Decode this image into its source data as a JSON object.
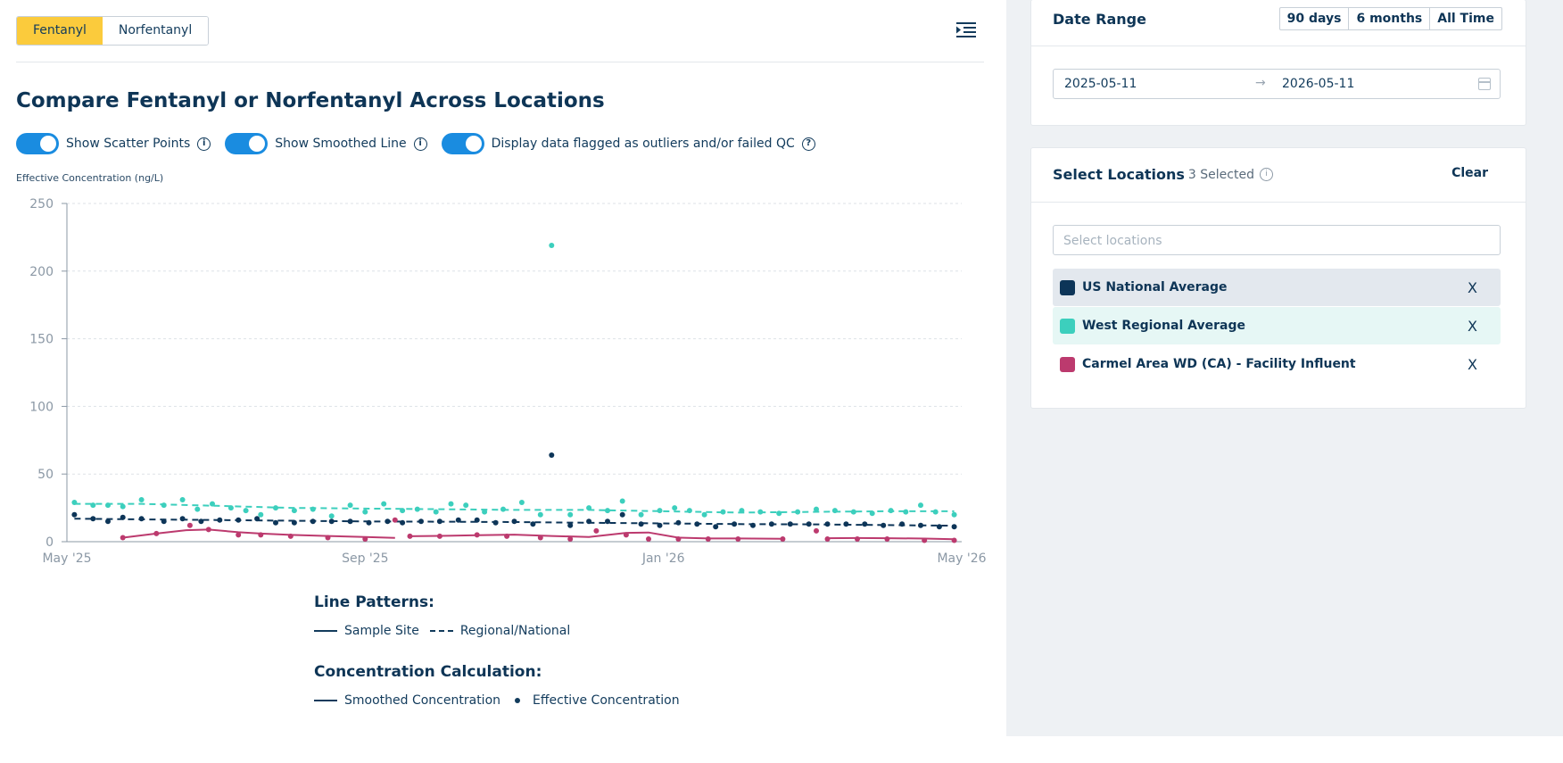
{
  "tabs": [
    {
      "label": "Fentanyl",
      "active": true
    },
    {
      "label": "Norfentanyl",
      "active": false
    }
  ],
  "page_title": "Compare Fentanyl or Norfentanyl Across Locations",
  "toggles": [
    {
      "label": "Show Scatter Points",
      "on": true,
      "icon": "info-icon"
    },
    {
      "label": "Show Smoothed Line",
      "on": true,
      "icon": "info-icon"
    },
    {
      "label": "Display data flagged as outliers and/or failed QC",
      "on": true,
      "icon": "help-icon"
    }
  ],
  "legend": {
    "patterns_title": "Line Patterns:",
    "sample_site": "Sample Site",
    "regional_national": "Regional/National",
    "calc_title": "Concentration Calculation:",
    "smoothed": "Smoothed Concentration",
    "effective": "Effective Concentration"
  },
  "date_range": {
    "title": "Date Range",
    "buttons": [
      "90 days",
      "6 months",
      "All Time"
    ],
    "start": "2025-05-11",
    "arrow": "→",
    "end": "2026-05-11"
  },
  "locations": {
    "title": "Select Locations",
    "count": "3 Selected",
    "clear": "Clear",
    "placeholder": "Select locations",
    "items": [
      {
        "name": "US National Average",
        "color": "#0d3558",
        "bg": "#e3e8ee"
      },
      {
        "name": "West Regional Average",
        "color": "#3ccfbd",
        "bg": "#e6f7f5"
      },
      {
        "name": "Carmel Area WD (CA) - Facility Influent",
        "color": "#bc3a6e",
        "bg": "#ffffff"
      }
    ],
    "remove": "X"
  },
  "colors": {
    "accent": "#fbcb3c",
    "toggle": "#1a8ce0",
    "navy": "#0d3558",
    "teal": "#3ccfbd",
    "magenta": "#bc3a6e"
  },
  "chart_data": {
    "type": "line",
    "ylabel": "Effective Concentration (ng/L)",
    "ylim": [
      0,
      250
    ],
    "yticks": [
      0,
      50,
      100,
      150,
      200,
      250
    ],
    "xticks": [
      {
        "label": "May '25",
        "t": 0
      },
      {
        "label": "Sep '25",
        "t": 4
      },
      {
        "label": "Jan '26",
        "t": 8
      },
      {
        "label": "May '26",
        "t": 12
      }
    ],
    "xlim": [
      0,
      12
    ],
    "grid": true,
    "series": [
      {
        "name": "US National Average",
        "color": "#0d3558",
        "dashed": true,
        "smoothed": [
          [
            0.1,
            17
          ],
          [
            1,
            16.5
          ],
          [
            2,
            16
          ],
          [
            3,
            15.5
          ],
          [
            4,
            15
          ],
          [
            5,
            14.8
          ],
          [
            6,
            14.5
          ],
          [
            7,
            14
          ],
          [
            8,
            13.5
          ],
          [
            9,
            13
          ],
          [
            10,
            12.8
          ],
          [
            11,
            12.3
          ],
          [
            11.9,
            11.8
          ]
        ],
        "points": [
          [
            0.1,
            20
          ],
          [
            0.35,
            17
          ],
          [
            0.55,
            15
          ],
          [
            0.75,
            18
          ],
          [
            1,
            17
          ],
          [
            1.3,
            15
          ],
          [
            1.55,
            17
          ],
          [
            1.8,
            15
          ],
          [
            2.05,
            16
          ],
          [
            2.3,
            16
          ],
          [
            2.55,
            17
          ],
          [
            2.8,
            14
          ],
          [
            3.05,
            14
          ],
          [
            3.3,
            15
          ],
          [
            3.55,
            15
          ],
          [
            3.8,
            15
          ],
          [
            4.05,
            14
          ],
          [
            4.3,
            15
          ],
          [
            4.5,
            14
          ],
          [
            4.75,
            15
          ],
          [
            5,
            15
          ],
          [
            5.25,
            16
          ],
          [
            5.5,
            16
          ],
          [
            5.75,
            14
          ],
          [
            6,
            15
          ],
          [
            6.25,
            13
          ],
          [
            6.5,
            64
          ],
          [
            6.75,
            12
          ],
          [
            7,
            15
          ],
          [
            7.25,
            15
          ],
          [
            7.45,
            20
          ],
          [
            7.7,
            13
          ],
          [
            7.95,
            12
          ],
          [
            8.2,
            14
          ],
          [
            8.45,
            13
          ],
          [
            8.7,
            11
          ],
          [
            8.95,
            13
          ],
          [
            9.2,
            12
          ],
          [
            9.45,
            13
          ],
          [
            9.7,
            13
          ],
          [
            9.95,
            13
          ],
          [
            10.2,
            13
          ],
          [
            10.45,
            13
          ],
          [
            10.7,
            13
          ],
          [
            10.95,
            12
          ],
          [
            11.2,
            13
          ],
          [
            11.45,
            12
          ],
          [
            11.7,
            11
          ],
          [
            11.9,
            11
          ]
        ]
      },
      {
        "name": "West Regional Average",
        "color": "#3ccfbd",
        "dashed": true,
        "smoothed": [
          [
            0.1,
            28
          ],
          [
            1,
            28
          ],
          [
            2,
            26.5
          ],
          [
            3,
            25
          ],
          [
            4,
            24.5
          ],
          [
            5,
            24
          ],
          [
            6,
            23.5
          ],
          [
            7,
            23.5
          ],
          [
            8,
            22.5
          ],
          [
            9,
            21.5
          ],
          [
            10,
            22
          ],
          [
            11,
            22.5
          ],
          [
            11.9,
            22.5
          ]
        ],
        "points": [
          [
            0.1,
            29
          ],
          [
            0.35,
            27
          ],
          [
            0.55,
            27
          ],
          [
            0.75,
            26
          ],
          [
            1,
            31
          ],
          [
            1.3,
            27
          ],
          [
            1.55,
            31
          ],
          [
            1.75,
            24
          ],
          [
            1.95,
            28
          ],
          [
            2.2,
            25
          ],
          [
            2.4,
            23
          ],
          [
            2.6,
            20
          ],
          [
            2.8,
            25
          ],
          [
            3.05,
            23
          ],
          [
            3.3,
            24
          ],
          [
            3.55,
            19
          ],
          [
            3.8,
            27
          ],
          [
            4,
            22
          ],
          [
            4.25,
            28
          ],
          [
            4.5,
            23
          ],
          [
            4.7,
            24
          ],
          [
            4.95,
            22
          ],
          [
            5.15,
            28
          ],
          [
            5.35,
            27
          ],
          [
            5.6,
            22
          ],
          [
            5.85,
            24
          ],
          [
            6.1,
            29
          ],
          [
            6.35,
            20
          ],
          [
            6.5,
            219
          ],
          [
            6.75,
            20
          ],
          [
            7,
            25
          ],
          [
            7.25,
            23
          ],
          [
            7.45,
            30
          ],
          [
            7.7,
            20
          ],
          [
            7.95,
            23
          ],
          [
            8.15,
            25
          ],
          [
            8.35,
            23
          ],
          [
            8.55,
            20
          ],
          [
            8.8,
            22
          ],
          [
            9.05,
            23
          ],
          [
            9.3,
            22
          ],
          [
            9.55,
            21
          ],
          [
            9.8,
            22
          ],
          [
            10.05,
            24
          ],
          [
            10.3,
            23
          ],
          [
            10.55,
            22
          ],
          [
            10.8,
            21
          ],
          [
            11.05,
            23
          ],
          [
            11.25,
            22
          ],
          [
            11.45,
            27
          ],
          [
            11.65,
            22
          ],
          [
            11.9,
            20
          ]
        ]
      },
      {
        "name": "Carmel Area WD (CA) - Facility Influent",
        "color": "#bc3a6e",
        "dashed": false,
        "smoothed_segments": [
          [
            [
              0.75,
              3
            ],
            [
              1.2,
              6
            ],
            [
              1.6,
              8.5
            ],
            [
              1.9,
              9
            ],
            [
              2.3,
              7
            ],
            [
              2.6,
              6
            ],
            [
              3,
              5
            ],
            [
              3.5,
              4.2
            ],
            [
              4,
              3.5
            ],
            [
              4.4,
              2.8
            ]
          ],
          [
            [
              4.6,
              4
            ],
            [
              5,
              4.3
            ],
            [
              5.5,
              4.8
            ],
            [
              6,
              5.2
            ],
            [
              6.5,
              4.2
            ],
            [
              7,
              3.5
            ],
            [
              7.5,
              6.5
            ],
            [
              7.8,
              6.8
            ],
            [
              8.2,
              3
            ],
            [
              8.6,
              2.4
            ],
            [
              9,
              2.4
            ],
            [
              9.6,
              2.2
            ]
          ],
          [
            [
              10.2,
              2.6
            ],
            [
              10.6,
              2.7
            ],
            [
              11,
              2.6
            ],
            [
              11.5,
              2.3
            ],
            [
              11.9,
              1.8
            ]
          ]
        ],
        "points": [
          [
            0.75,
            3
          ],
          [
            1.2,
            6
          ],
          [
            1.65,
            12
          ],
          [
            1.9,
            9
          ],
          [
            2.3,
            5
          ],
          [
            2.6,
            5
          ],
          [
            3,
            4
          ],
          [
            3.5,
            3
          ],
          [
            4,
            2
          ],
          [
            4.4,
            16
          ],
          [
            4.6,
            4
          ],
          [
            5,
            4
          ],
          [
            5.5,
            5
          ],
          [
            5.9,
            4
          ],
          [
            6.35,
            3
          ],
          [
            6.75,
            2
          ],
          [
            7.1,
            8
          ],
          [
            7.5,
            5
          ],
          [
            7.8,
            2
          ],
          [
            8.2,
            2
          ],
          [
            8.6,
            2
          ],
          [
            9,
            2
          ],
          [
            9.6,
            2
          ],
          [
            10.05,
            8
          ],
          [
            10.2,
            2
          ],
          [
            10.6,
            2
          ],
          [
            11,
            2
          ],
          [
            11.5,
            1
          ],
          [
            11.9,
            1
          ]
        ]
      }
    ]
  }
}
